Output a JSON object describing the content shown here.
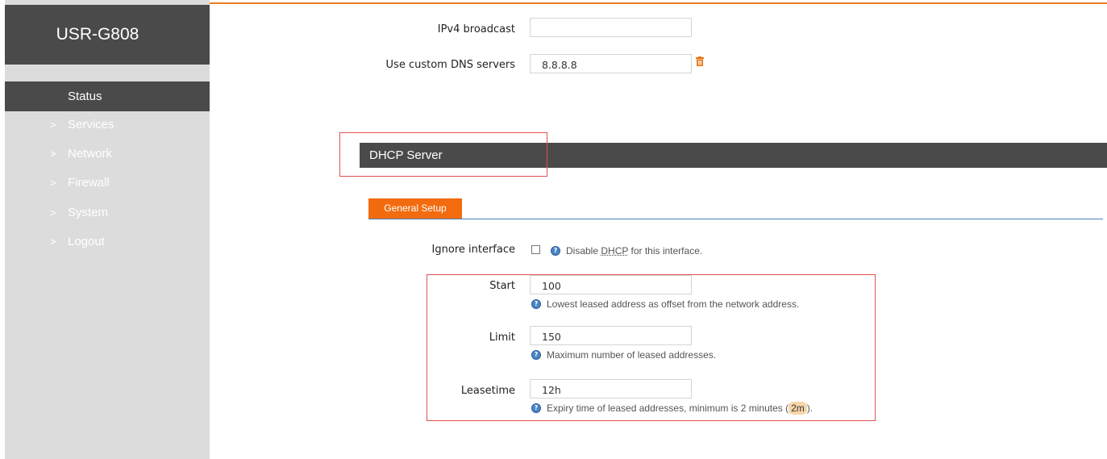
{
  "sidebar": {
    "brand": "USR-G808",
    "active": "Status",
    "items": [
      {
        "label": "Services"
      },
      {
        "label": "Network"
      },
      {
        "label": "Firewall"
      },
      {
        "label": "System"
      },
      {
        "label": "Logout"
      }
    ],
    "chevron": ">"
  },
  "form_top": {
    "broadcast_label": "IPv4 broadcast",
    "broadcast_value": "",
    "dns_label": "Use custom DNS servers",
    "dns_value": "8.8.8.8"
  },
  "dhcp": {
    "title": "DHCP Server",
    "tab_general": "General Setup",
    "ignore_label": "Ignore interface",
    "ignore_hint_pre": "Disable ",
    "ignore_hint_abbr": "DHCP",
    "ignore_hint_post": " for this interface.",
    "ignore_checked": false,
    "start_label": "Start",
    "start_value": "100",
    "start_hint": "Lowest leased address as offset from the network address.",
    "limit_label": "Limit",
    "limit_value": "150",
    "limit_hint": "Maximum number of leased addresses.",
    "lease_label": "Leasetime",
    "lease_value": "12h",
    "lease_hint_pre": "Expiry time of leased addresses, minimum is 2 minutes (",
    "lease_hint_code": "2m",
    "lease_hint_post": ")."
  },
  "icons": {
    "help": "?",
    "trash": "trash-icon"
  },
  "colors": {
    "accent": "#f26b0f",
    "header_dark": "#4a4a4a",
    "sidebar_bg": "#dcdcdc",
    "highlight_box": "#e05050",
    "tab_line": "#4a7fbf"
  }
}
